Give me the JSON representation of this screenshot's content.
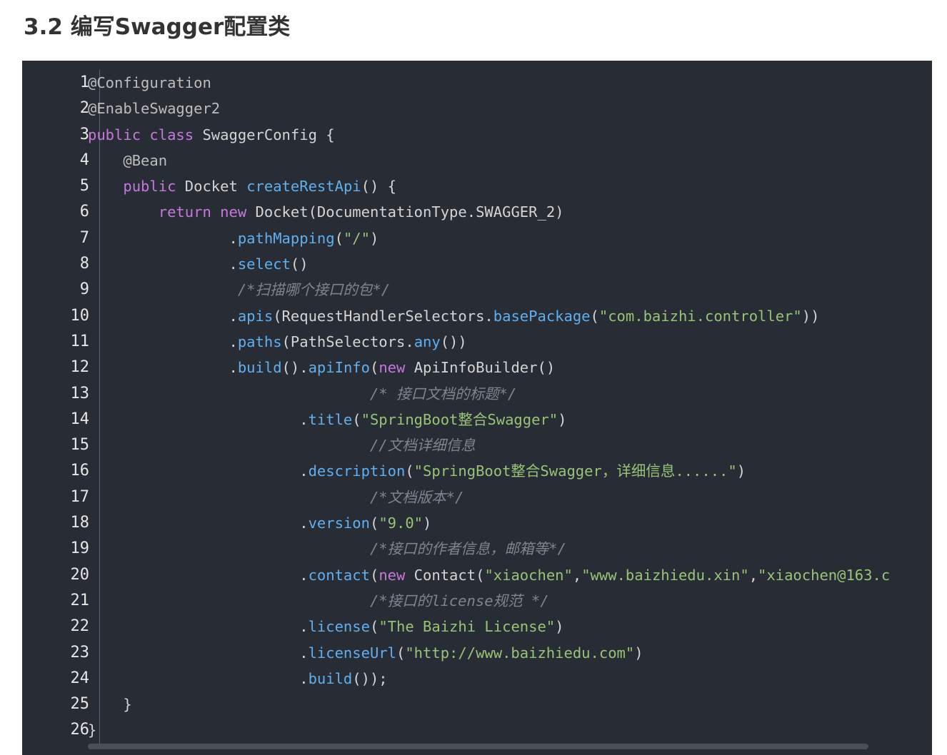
{
  "heading": "3.2 编写Swagger配置类",
  "lines": [
    [
      [
        "ann",
        "@Configuration"
      ]
    ],
    [
      [
        "ann",
        "@EnableSwagger2"
      ]
    ],
    [
      [
        "kw",
        "public"
      ],
      [
        "pl",
        " "
      ],
      [
        "kw",
        "class"
      ],
      [
        "pl",
        " SwaggerConfig {"
      ]
    ],
    [
      [
        "pl",
        "    "
      ],
      [
        "ann",
        "@Bean"
      ]
    ],
    [
      [
        "pl",
        "    "
      ],
      [
        "kw",
        "public"
      ],
      [
        "pl",
        " Docket "
      ],
      [
        "fn",
        "createRestApi"
      ],
      [
        "pl",
        "() {"
      ]
    ],
    [
      [
        "pl",
        "        "
      ],
      [
        "kw",
        "return"
      ],
      [
        "pl",
        " "
      ],
      [
        "kw",
        "new"
      ],
      [
        "pl",
        " Docket(DocumentationType.SWAGGER_2)"
      ]
    ],
    [
      [
        "pl",
        "                ."
      ],
      [
        "fn",
        "pathMapping"
      ],
      [
        "pl",
        "("
      ],
      [
        "str",
        "\"/\""
      ],
      [
        "pl",
        ")"
      ]
    ],
    [
      [
        "pl",
        "                ."
      ],
      [
        "fn",
        "select"
      ],
      [
        "pl",
        "()"
      ]
    ],
    [
      [
        "pl",
        "                 "
      ],
      [
        "cm",
        "/*扫描哪个接口的包*/"
      ]
    ],
    [
      [
        "pl",
        "                ."
      ],
      [
        "fn",
        "apis"
      ],
      [
        "pl",
        "(RequestHandlerSelectors."
      ],
      [
        "fn",
        "basePackage"
      ],
      [
        "pl",
        "("
      ],
      [
        "str",
        "\"com.baizhi.controller\""
      ],
      [
        "pl",
        "))"
      ]
    ],
    [
      [
        "pl",
        "                ."
      ],
      [
        "fn",
        "paths"
      ],
      [
        "pl",
        "(PathSelectors."
      ],
      [
        "fn",
        "any"
      ],
      [
        "pl",
        "())"
      ]
    ],
    [
      [
        "pl",
        "                ."
      ],
      [
        "fn",
        "build"
      ],
      [
        "pl",
        "()."
      ],
      [
        "fn",
        "apiInfo"
      ],
      [
        "pl",
        "("
      ],
      [
        "kw",
        "new"
      ],
      [
        "pl",
        " ApiInfoBuilder()"
      ]
    ],
    [
      [
        "pl",
        "                                "
      ],
      [
        "cm",
        "/* 接口文档的标题*/"
      ]
    ],
    [
      [
        "pl",
        "                        ."
      ],
      [
        "fn",
        "title"
      ],
      [
        "pl",
        "("
      ],
      [
        "str",
        "\"SpringBoot整合Swagger\""
      ],
      [
        "pl",
        ")"
      ]
    ],
    [
      [
        "pl",
        "                                "
      ],
      [
        "cm",
        "//文档详细信息"
      ]
    ],
    [
      [
        "pl",
        "                        ."
      ],
      [
        "fn",
        "description"
      ],
      [
        "pl",
        "("
      ],
      [
        "str",
        "\"SpringBoot整合Swagger，详细信息......\""
      ],
      [
        "pl",
        ")"
      ]
    ],
    [
      [
        "pl",
        "                                "
      ],
      [
        "cm",
        "/*文档版本*/"
      ]
    ],
    [
      [
        "pl",
        "                        ."
      ],
      [
        "fn",
        "version"
      ],
      [
        "pl",
        "("
      ],
      [
        "str",
        "\"9.0\""
      ],
      [
        "pl",
        ")"
      ]
    ],
    [
      [
        "pl",
        "                                "
      ],
      [
        "cm",
        "/*接口的作者信息，邮箱等*/"
      ]
    ],
    [
      [
        "pl",
        "                        ."
      ],
      [
        "fn",
        "contact"
      ],
      [
        "pl",
        "("
      ],
      [
        "kw",
        "new"
      ],
      [
        "pl",
        " Contact("
      ],
      [
        "str",
        "\"xiaochen\""
      ],
      [
        "pl",
        ","
      ],
      [
        "str",
        "\"www.baizhiedu.xin\""
      ],
      [
        "pl",
        ","
      ],
      [
        "str",
        "\"xiaochen@163.c"
      ]
    ],
    [
      [
        "pl",
        "                                "
      ],
      [
        "cm",
        "/*接口的license规范 */"
      ]
    ],
    [
      [
        "pl",
        "                        ."
      ],
      [
        "fn",
        "license"
      ],
      [
        "pl",
        "("
      ],
      [
        "str",
        "\"The Baizhi License\""
      ],
      [
        "pl",
        ")"
      ]
    ],
    [
      [
        "pl",
        "                        ."
      ],
      [
        "fn",
        "licenseUrl"
      ],
      [
        "pl",
        "("
      ],
      [
        "str",
        "\"http://www.baizhiedu.com\""
      ],
      [
        "pl",
        ")"
      ]
    ],
    [
      [
        "pl",
        "                        ."
      ],
      [
        "fn",
        "build"
      ],
      [
        "pl",
        "());"
      ]
    ],
    [
      [
        "pl",
        "    }"
      ]
    ],
    [
      [
        "pl",
        "}"
      ]
    ]
  ]
}
